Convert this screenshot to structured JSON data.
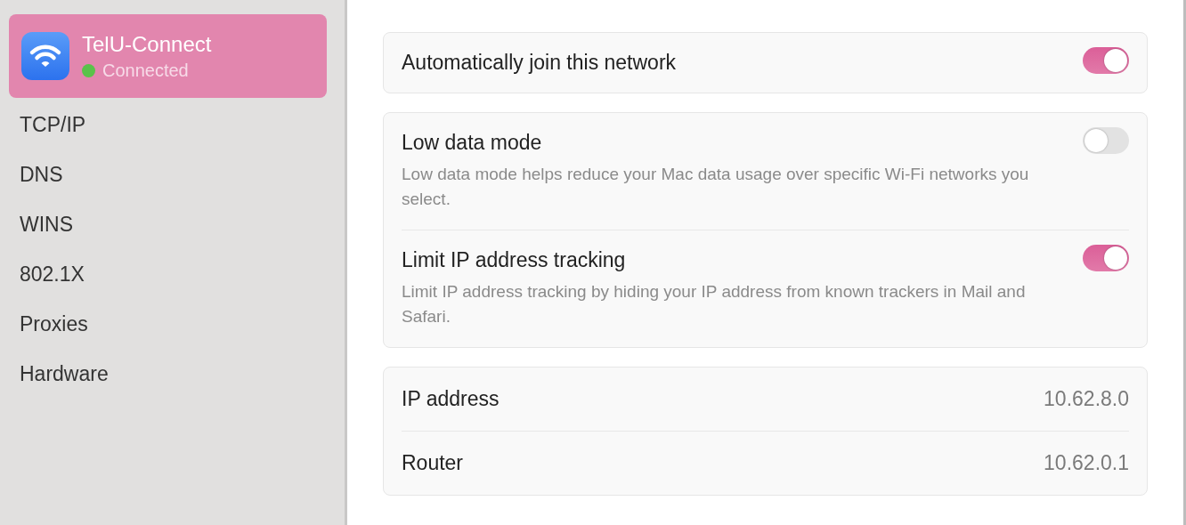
{
  "network": {
    "name": "TelU-Connect",
    "status": "Connected",
    "connected": true,
    "selected": true
  },
  "sidebar": {
    "items": [
      {
        "label": "TCP/IP",
        "selected": false
      },
      {
        "label": "DNS",
        "selected": false
      },
      {
        "label": "WINS",
        "selected": false
      },
      {
        "label": "802.1X",
        "selected": false
      },
      {
        "label": "Proxies",
        "selected": false
      },
      {
        "label": "Hardware",
        "selected": false
      }
    ]
  },
  "groups": [
    {
      "rows": [
        {
          "kind": "toggle",
          "title": "Automatically join this network",
          "on": true
        }
      ]
    },
    {
      "rows": [
        {
          "kind": "toggle",
          "title": "Low data mode",
          "description": "Low data mode helps reduce your Mac data usage over specific Wi-Fi networks you select.",
          "on": false
        },
        {
          "kind": "toggle",
          "title": "Limit IP address tracking",
          "description": "Limit IP address tracking by hiding your IP address from known trackers in Mail and Safari.",
          "on": true
        }
      ]
    },
    {
      "rows": [
        {
          "kind": "value",
          "label": "IP address",
          "value": "10.62.8.0"
        },
        {
          "kind": "value",
          "label": "Router",
          "value": "10.62.0.1"
        }
      ]
    }
  ]
}
